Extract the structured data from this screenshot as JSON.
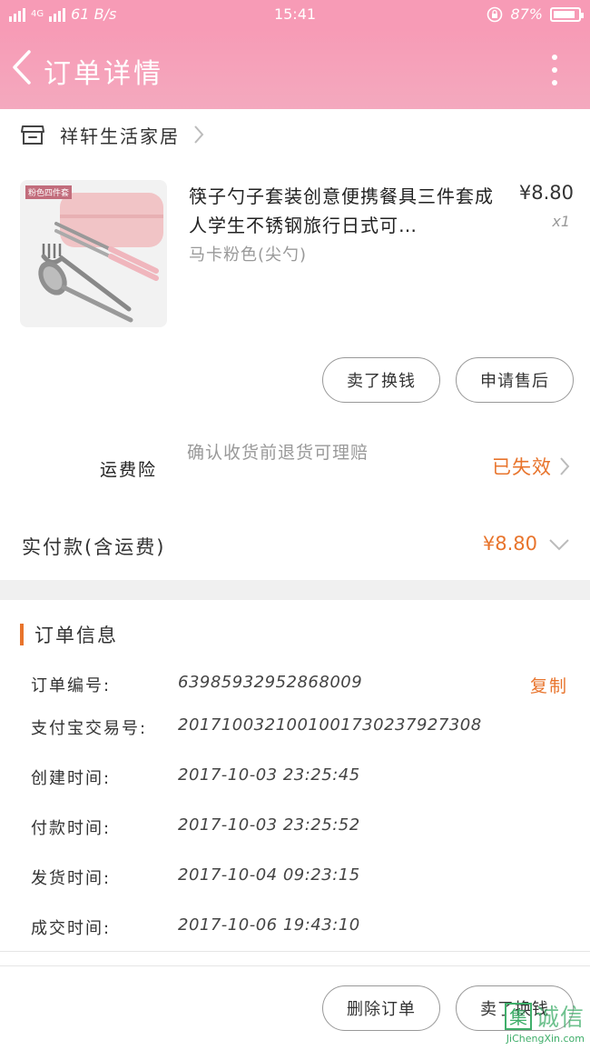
{
  "status_bar": {
    "network": "4G",
    "speed": "61 B/s",
    "time": "15:41",
    "battery": "87%",
    "battery_level": 0.87
  },
  "header": {
    "title": "订单详情"
  },
  "store": {
    "name": "祥轩生活家居"
  },
  "product": {
    "image_tag": "粉色四件套",
    "title": "筷子勺子套装创意便携餐具三件套成人学生不锈钢旅行日式可…",
    "price": "¥8.80",
    "quantity": "x1",
    "variant": "马卡粉色(尖勺)"
  },
  "item_actions": {
    "remind_label": "卖了换钱",
    "after_sale_label": "申请售后"
  },
  "shipping_insurance": {
    "label": "运费险",
    "description": "确认收货前退货可理赔",
    "status": "已失效"
  },
  "payment": {
    "label": "实付款(含运费)",
    "amount": "¥8.80"
  },
  "order_info": {
    "title": "订单信息",
    "copy_label": "复制",
    "rows": [
      {
        "key": "订单编号:",
        "value": "63985932952868009"
      },
      {
        "key": "支付宝交易号:",
        "value": "2017100321001001730237927308"
      },
      {
        "key": "创建时间:",
        "value": "2017-10-03 23:25:45"
      },
      {
        "key": "付款时间:",
        "value": "2017-10-03 23:25:52"
      },
      {
        "key": "发货时间:",
        "value": "2017-10-04 09:23:15"
      },
      {
        "key": "成交时间:",
        "value": "2017-10-06 19:43:10"
      }
    ]
  },
  "footer": {
    "delete_label": "删除订单",
    "sell_label": "卖了换钱"
  },
  "watermark": {
    "mark": "集",
    "cn": "诚信",
    "en": "JiChengXin.com"
  }
}
